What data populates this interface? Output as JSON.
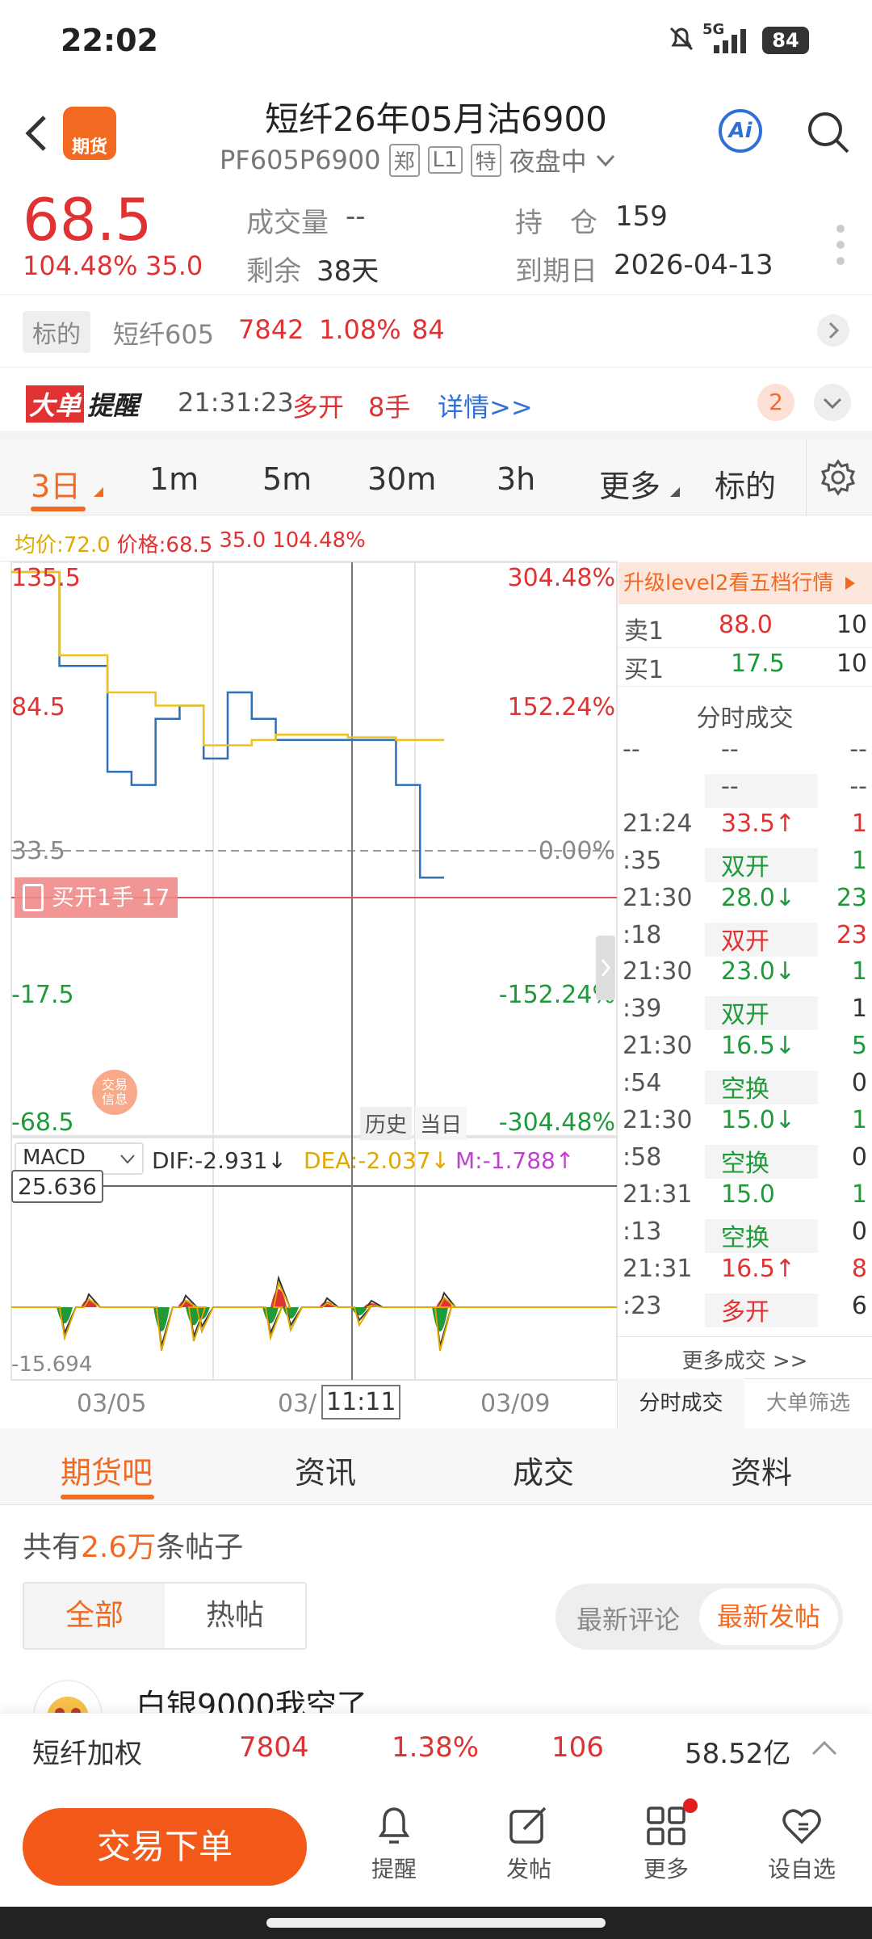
{
  "status": {
    "time": "22:02",
    "battery": "84",
    "network": "5G"
  },
  "header": {
    "title": "短纤26年05月沽6900",
    "code": "PF605P6900",
    "badge1": "郑",
    "badge2": "L1",
    "badge3": "特",
    "session": "夜盘中",
    "app_logo": "期货",
    "ai": "Ai"
  },
  "quote": {
    "price": "68.5",
    "pct": "104.48%",
    "change": "35.0",
    "volume_label": "成交量",
    "volume_value": "--",
    "oi_label": "持　仓",
    "oi_value": "159",
    "remain_label": "剩余",
    "remain_value": "38天",
    "expiry_label": "到期日",
    "expiry_value": "2026-04-13"
  },
  "underlying": {
    "tag": "标的",
    "name": "短纤605",
    "price": "7842",
    "pct": "1.08%",
    "change": "84"
  },
  "alert": {
    "logo_big": "大单",
    "logo_remind": "提醒",
    "time": "21:31:23",
    "action": "多开",
    "qty": "8手",
    "detail": "详情>>",
    "count": "2"
  },
  "periods": {
    "tabs": [
      "3日",
      "1m",
      "5m",
      "30m",
      "3h",
      "更多",
      "标的"
    ],
    "active": "3日"
  },
  "chart": {
    "legend_avg": "均价:72.0",
    "legend_price": "价格:68.5",
    "legend_chg": "35.0",
    "legend_pct": "104.48%",
    "y_left": [
      "135.5",
      "84.5",
      "33.5",
      "-17.5",
      "-68.5"
    ],
    "y_right": [
      "304.48%",
      "152.24%",
      "0.00%",
      "-152.24%",
      "-304.48%"
    ],
    "order_tag": "买开1手 17",
    "trade_info": "交易信息",
    "history": "历史",
    "today": "当日",
    "macd_sel": "MACD",
    "dif": "DIF:-2.931↓",
    "dea": "DEA:-2.037↓",
    "m": "M:-1.788↑",
    "macd_max": "25.636",
    "macd_min": "-15.694",
    "x_labels": [
      "03/05",
      "03/",
      "11:11",
      "03/09"
    ]
  },
  "chart_data": {
    "type": "line",
    "series": [
      {
        "name": "价格",
        "color": "#2f6fb5",
        "values": [
          135.5,
          135.5,
          100,
          100,
          60,
          55,
          80,
          85,
          65,
          90,
          80,
          72,
          72,
          72,
          72,
          72,
          55,
          20,
          20
        ]
      },
      {
        "name": "均价",
        "color": "#f0c020",
        "values": [
          135.5,
          135.5,
          104,
          104,
          90,
          90,
          85,
          85,
          70,
          70,
          72,
          74,
          74,
          74,
          73,
          73,
          72,
          72,
          72
        ]
      }
    ],
    "ylim": [
      -68.5,
      135.5
    ],
    "xlabels": [
      "03/05",
      "03/",
      "03/09"
    ]
  },
  "side": {
    "upgrade": "升级level2看五档行情",
    "ask_label": "卖1",
    "ask_price": "88.0",
    "ask_vol": "10",
    "bid_label": "买1",
    "bid_price": "17.5",
    "bid_vol": "10",
    "ticks_title": "分时成交",
    "rows": [
      {
        "t": "--",
        "p": "--",
        "v": "--"
      },
      {
        "t": "",
        "p": "--",
        "v": "--"
      },
      {
        "t": "21:24",
        "p": "33.5↑",
        "v": "1",
        "pc": "red"
      },
      {
        "t": ":35",
        "p": "双开",
        "v": "1",
        "pc": "green"
      },
      {
        "t": "21:30",
        "p": "28.0↓",
        "v": "23",
        "pc": "green"
      },
      {
        "t": ":18",
        "p": "双开",
        "v": "23",
        "pc": "red"
      },
      {
        "t": "21:30",
        "p": "23.0↓",
        "v": "1",
        "pc": "green"
      },
      {
        "t": ":39",
        "p": "双开",
        "v": "1",
        "pc": "green"
      },
      {
        "t": "21:30",
        "p": "16.5↓",
        "v": "5",
        "pc": "green"
      },
      {
        "t": ":54",
        "p": "空换",
        "v": "0",
        "pc": "green"
      },
      {
        "t": "21:30",
        "p": "15.0↓",
        "v": "1",
        "pc": "green"
      },
      {
        "t": ":58",
        "p": "空换",
        "v": "0",
        "pc": "green"
      },
      {
        "t": "21:31",
        "p": "15.0",
        "v": "1",
        "pc": "green"
      },
      {
        "t": ":13",
        "p": "空换",
        "v": "0",
        "pc": "green"
      },
      {
        "t": "21:31",
        "p": "16.5↑",
        "v": "8",
        "pc": "red"
      },
      {
        "t": ":23",
        "p": "多开",
        "v": "6",
        "pc": "red"
      }
    ],
    "more": "更多成交 >>",
    "tab1": "分时成交",
    "tab2": "大单筛选"
  },
  "forum": {
    "tabs": [
      "期货吧",
      "资讯",
      "成交",
      "资料"
    ],
    "count_pre": "共有",
    "count_num": "2.6万",
    "count_post": "条帖子",
    "filter_all": "全部",
    "filter_hot": "热帖",
    "sort1": "最新评论",
    "sort2": "最新发帖",
    "post_title": "白银9000我空了"
  },
  "ticker": {
    "name": "短纤加权",
    "price": "7804",
    "pct": "1.38%",
    "change": "106",
    "amount": "58.52亿"
  },
  "nav": {
    "trade": "交易下单",
    "items": [
      "提醒",
      "发帖",
      "更多",
      "设自选"
    ]
  }
}
